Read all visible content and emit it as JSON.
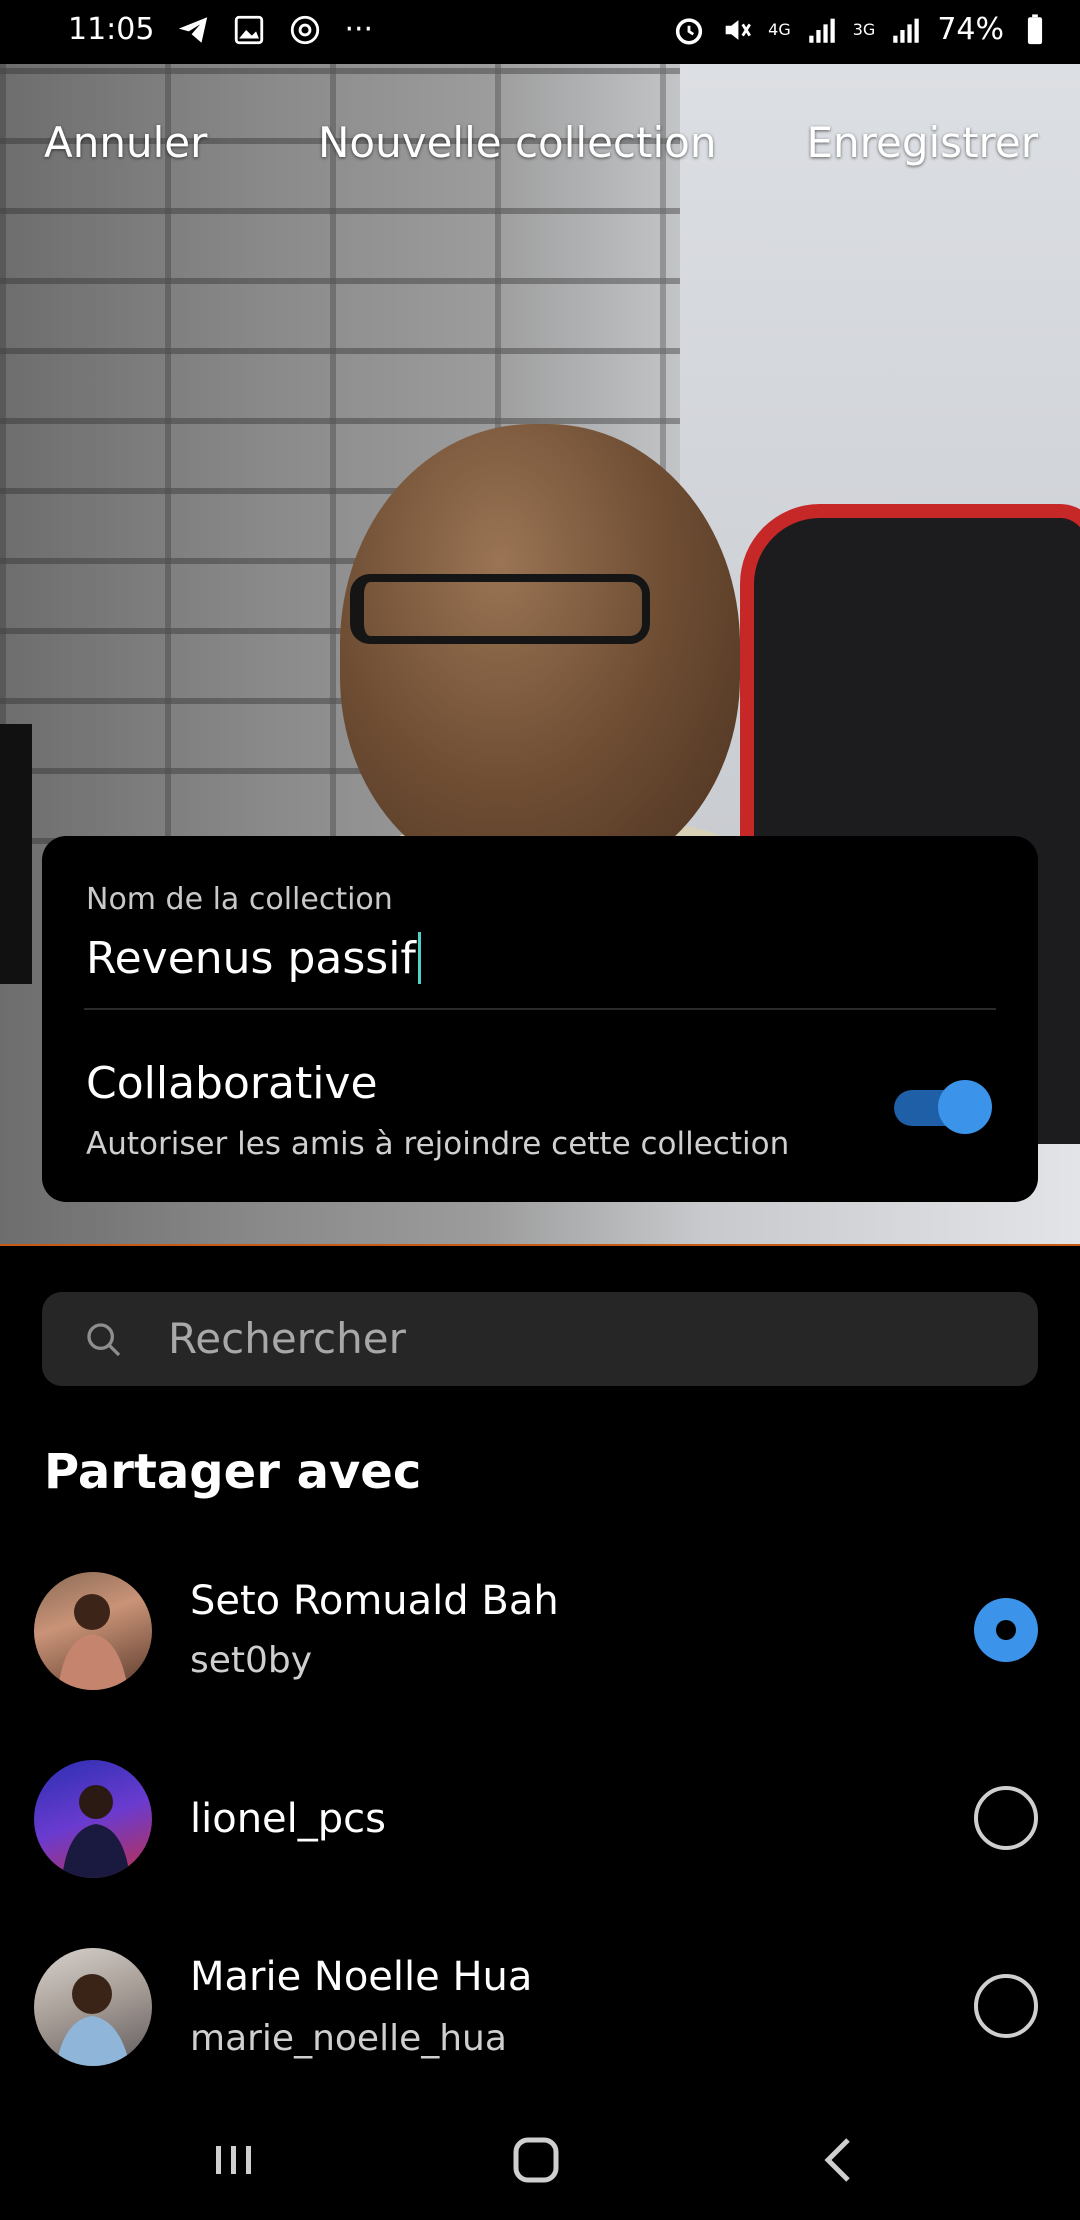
{
  "status_bar": {
    "time": "11:05",
    "battery": "74%",
    "net1": "4G",
    "net2": "3G"
  },
  "header": {
    "cancel": "Annuler",
    "title": "Nouvelle collection",
    "save": "Enregistrer"
  },
  "collection": {
    "label": "Nom de la collection",
    "value": "Revenus passif",
    "collab_title": "Collaborative",
    "collab_sub": "Autoriser les amis à rejoindre cette collection",
    "collab_enabled": true
  },
  "search": {
    "placeholder": "Rechercher"
  },
  "share": {
    "title": "Partager avec",
    "people": [
      {
        "name": "Seto Romuald Bah",
        "username": "set0by",
        "selected": true
      },
      {
        "name": "lionel_pcs",
        "username": "",
        "selected": false
      },
      {
        "name": "Marie Noelle Hua",
        "username": "marie_noelle_hua",
        "selected": false
      }
    ]
  },
  "colors": {
    "accent": "#3b93ea",
    "background": "#000000",
    "search_bg": "#262626"
  }
}
